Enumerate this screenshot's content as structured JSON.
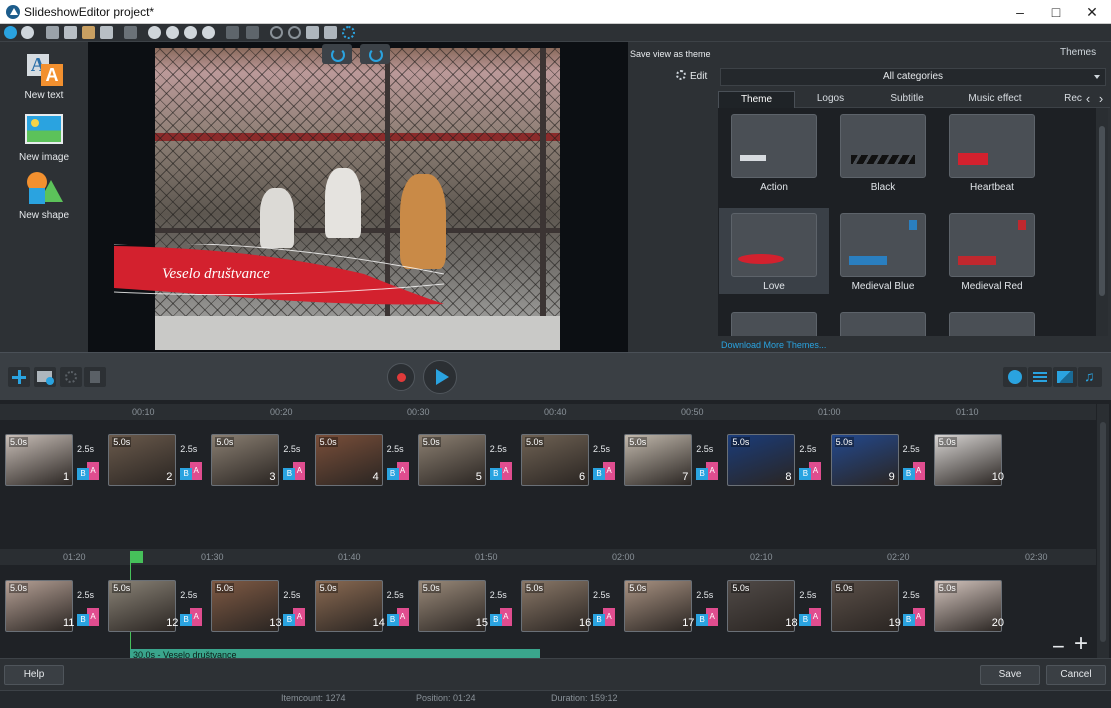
{
  "window": {
    "title": "SlideshowEditor project*"
  },
  "left_tools": [
    {
      "label": "New text",
      "icon": "new-text-icon"
    },
    {
      "label": "New image",
      "icon": "new-image-icon"
    },
    {
      "label": "New shape",
      "icon": "new-shape-icon"
    }
  ],
  "preview": {
    "caption": "Veselo društvance",
    "save_view_label": "Save view as theme",
    "edit_label": "Edit"
  },
  "themes": {
    "header": "Themes",
    "category": "All categories",
    "tabs": [
      "Theme",
      "Logos",
      "Subtitle",
      "Music effect",
      "Rec"
    ],
    "items": [
      "Action",
      "Black",
      "Heartbeat",
      "Love",
      "Medieval Blue",
      "Medieval Red"
    ],
    "selected": "Love",
    "download_link": "Download More Themes..."
  },
  "timeline": {
    "row1_ticks": [
      "00:10",
      "00:20",
      "00:30",
      "00:40",
      "00:50",
      "01:00",
      "01:10"
    ],
    "row2_ticks": [
      "01:20",
      "01:30",
      "01:40",
      "01:50",
      "02:00",
      "02:10",
      "02:20",
      "02:30"
    ],
    "clip_duration": "5.0s",
    "transition_duration": "2.5s",
    "clip_numbers_row1": [
      "1",
      "2",
      "3",
      "4",
      "5",
      "6",
      "7",
      "8",
      "9",
      "10"
    ],
    "clip_numbers_row2": [
      "11",
      "12",
      "13",
      "14",
      "15",
      "16",
      "17",
      "18",
      "19",
      "20"
    ],
    "text_track": "30.0s - Veselo društvance"
  },
  "bottom": {
    "help": "Help",
    "save": "Save",
    "cancel": "Cancel"
  },
  "status": {
    "itemcount": "Itemcount: 1274",
    "position": "Position: 01:24",
    "duration": "Duration: 159:12"
  },
  "colors": {
    "accent": "#2aa3e0",
    "record": "#e03a3a",
    "playhead": "#46c05a",
    "text_track": "#3aa58c",
    "transition_a": "#e04d8f",
    "transition_b": "#2aa3e0"
  }
}
